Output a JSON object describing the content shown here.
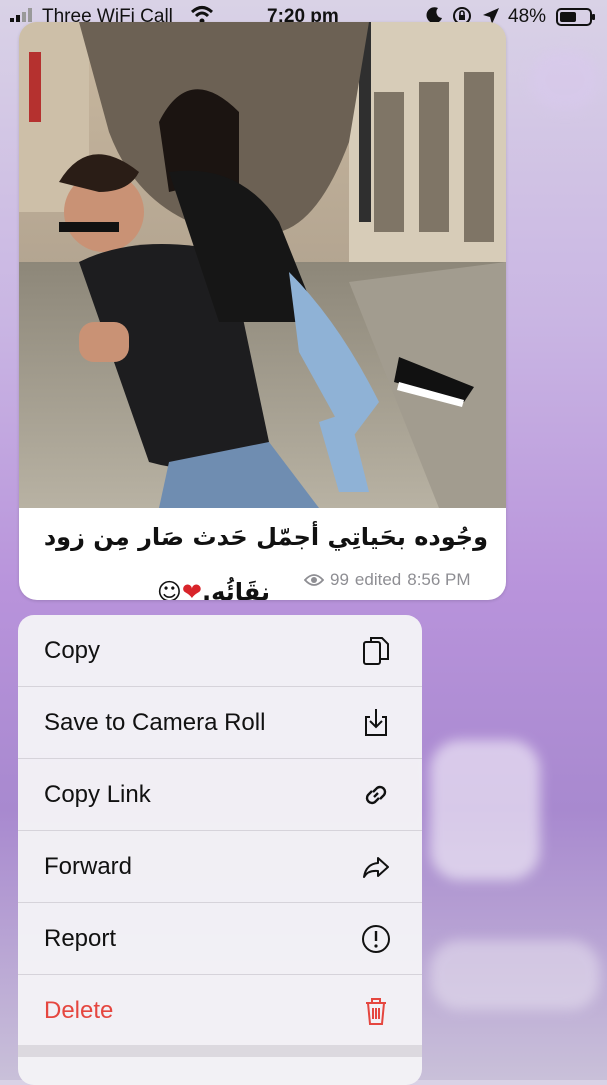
{
  "status_bar": {
    "carrier": "Three WiFi Call",
    "time": "7:20 pm",
    "battery_percent": "48%",
    "icons": [
      "signal-icon",
      "wifi-icon",
      "moon-icon",
      "orientation-lock-icon",
      "location-icon",
      "battery-icon"
    ]
  },
  "message": {
    "caption_line1": "وجُوده بحَياتِي أجمّل حَدث صَار مِن زود",
    "caption_line2": "نقَائُه.",
    "emojis": "❤️ ☺",
    "views": "99",
    "status": "edited",
    "time": "8:56 PM",
    "photo_alt": "photo"
  },
  "menu": {
    "items": [
      {
        "label": "Copy",
        "icon": "copy-icon"
      },
      {
        "label": "Save to Camera Roll",
        "icon": "save-download-icon"
      },
      {
        "label": "Copy Link",
        "icon": "link-icon"
      },
      {
        "label": "Forward",
        "icon": "forward-icon"
      },
      {
        "label": "Report",
        "icon": "report-icon"
      },
      {
        "label": "Delete",
        "icon": "trash-icon"
      }
    ],
    "delete_color": "#e5463f"
  }
}
